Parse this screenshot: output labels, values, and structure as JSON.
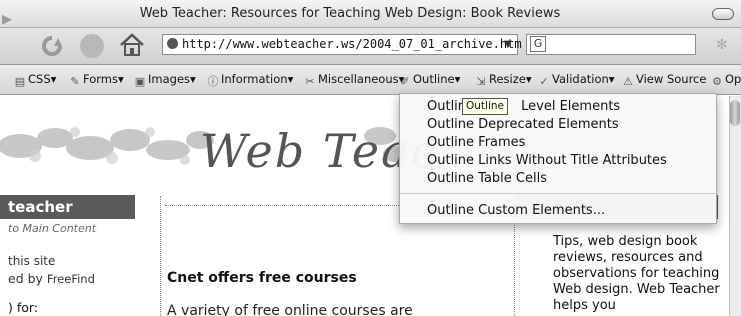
{
  "window": {
    "title": "Web Teacher: Resources for Teaching Web Design: Book Reviews"
  },
  "nav": {
    "url": "http://www.webteacher.ws/2004_07_01_archive.htm",
    "search_value": "G",
    "icons": [
      "forward-arrow-icon",
      "reload-icon",
      "stop-icon",
      "home-icon",
      "lock-icon",
      "google-icon",
      "spinner-icon"
    ]
  },
  "devtoolbar": {
    "items": [
      {
        "label": "CSS",
        "icon": "css-icon"
      },
      {
        "label": "Forms",
        "icon": "forms-icon"
      },
      {
        "label": "Images",
        "icon": "images-icon"
      },
      {
        "label": "Information",
        "icon": "information-icon"
      },
      {
        "label": "Miscellaneous",
        "icon": "miscellaneous-icon"
      },
      {
        "label": "Outline",
        "icon": "outline-icon"
      },
      {
        "label": "Resize",
        "icon": "resize-icon"
      },
      {
        "label": "Validation",
        "icon": "validation-icon"
      },
      {
        "label": "View Source",
        "icon": "view-source-icon"
      },
      {
        "label": "Op",
        "icon": "options-icon"
      }
    ]
  },
  "menu": {
    "items": [
      "Outline Block Level Elements",
      "Outline Deprecated Elements",
      "Outline Frames",
      "Outline Links Without Title Attributes",
      "Outline Table Cells",
      "Outline Custom Elements..."
    ],
    "item1_prefix": "Outlir",
    "item1_suffix": "Level Elements",
    "tooltip": "Outline"
  },
  "page": {
    "logo": "Web Teac",
    "left": {
      "header": "teacher",
      "skip": "to Main Content",
      "search_site": "this site",
      "powered_prefix": "ed by",
      "powered_by": "FreeFind",
      "look_for": ") for:"
    },
    "article": {
      "title": "Cnet offers free courses",
      "body": "A variety of free online courses are"
    },
    "right": {
      "text": "Tips, web design book reviews, resources and observations for teaching Web design. Web Teacher helps you"
    }
  },
  "colors": {
    "sidebar_header": "#5a5a5a",
    "tooltip_bg": "#ffffe6"
  }
}
